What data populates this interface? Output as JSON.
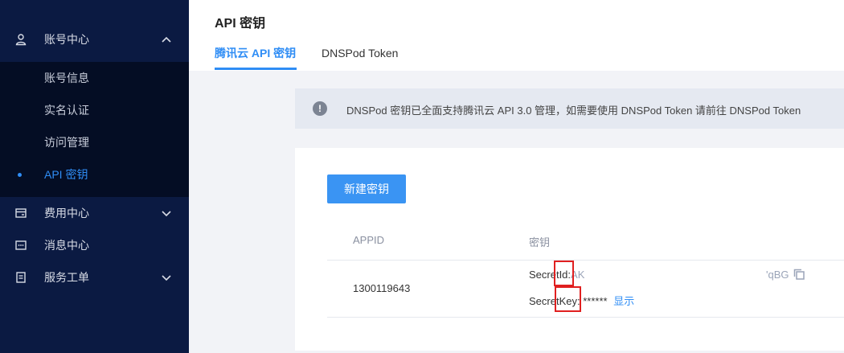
{
  "sidebar": {
    "groups": [
      {
        "label": "账号中心",
        "icon": "user-icon",
        "expanded": true
      },
      {
        "label": "费用中心",
        "icon": "wallet-icon",
        "expanded": false
      },
      {
        "label": "消息中心",
        "icon": "message-icon",
        "expanded": false
      },
      {
        "label": "服务工单",
        "icon": "ticket-icon",
        "expanded": false
      }
    ],
    "sub_items": [
      {
        "label": "账号信息",
        "active": false
      },
      {
        "label": "实名认证",
        "active": false
      },
      {
        "label": "访问管理",
        "active": false
      },
      {
        "label": "API 密钥",
        "active": true
      }
    ]
  },
  "header": {
    "title": "API 密钥",
    "tabs": [
      {
        "label": "腾讯云 API 密钥",
        "active": true
      },
      {
        "label": "DNSPod Token",
        "active": false
      }
    ]
  },
  "notice": {
    "icon": "info-icon",
    "text": "DNSPod 密钥已全面支持腾讯云 API 3.0 管理，如需要使用 DNSPod Token 请前往 DNSPod Token"
  },
  "card": {
    "create_button": "新建密钥",
    "columns": [
      "APPID",
      "密钥"
    ],
    "row": {
      "appid": "1300119643",
      "secret_id_label": "SecretId:",
      "secret_id_value": "AK",
      "secret_id_tail": "'qBG",
      "secret_key_label": "SecretKey:",
      "secret_key_value": "******",
      "show_link": "显示"
    }
  },
  "colors": {
    "sidebar_bg": "#0b1a42",
    "accent": "#2f8df5",
    "highlight": "#e02020"
  }
}
